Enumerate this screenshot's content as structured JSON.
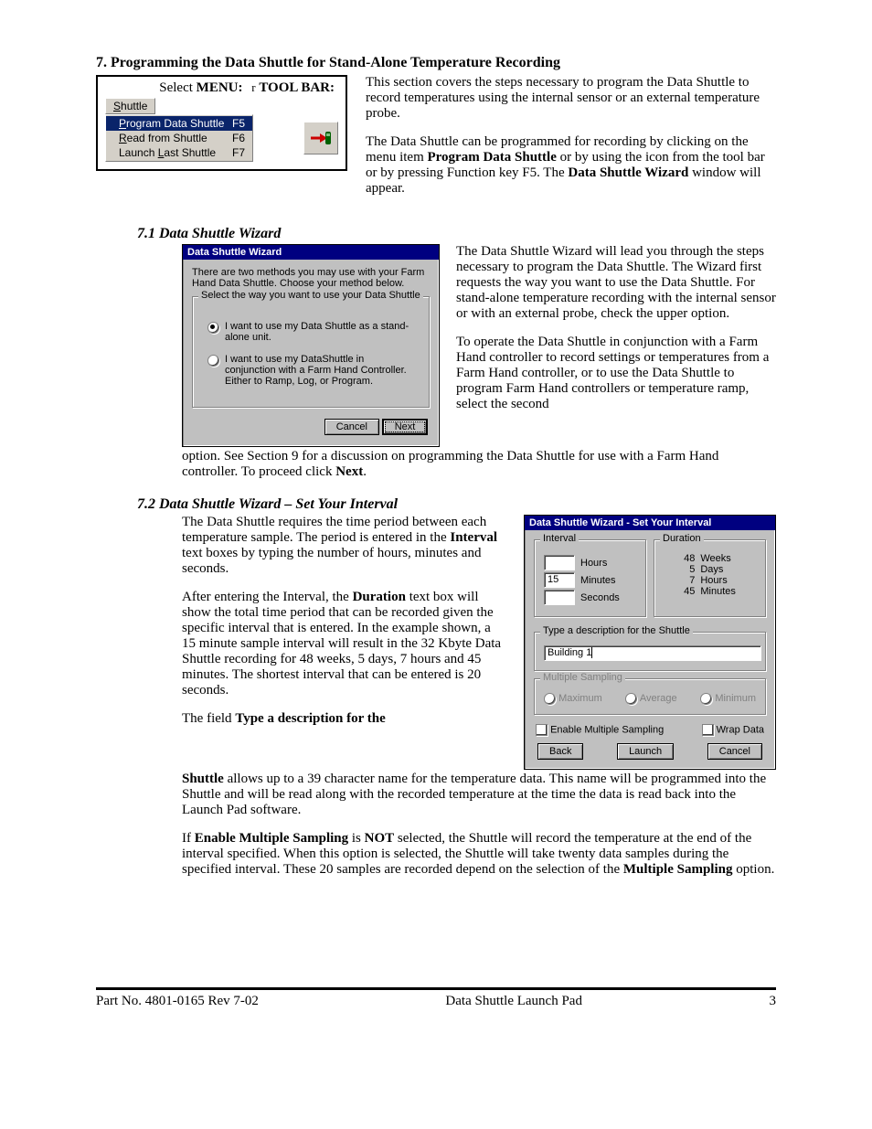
{
  "heading": "7.  Programming the Data Shuttle for Stand-Alone Temperature Recording",
  "menuFigure": {
    "selectLabel": "Select ",
    "menuWord": "MENU:",
    "or": "r",
    "toolbarWord": "TOOL BAR:",
    "shuttleBtn": "Shuttle",
    "items": [
      {
        "label": "Program Data Shuttle",
        "accel": "F5",
        "selected": true,
        "u": "P"
      },
      {
        "label": "Read from Shuttle",
        "accel": "F6",
        "selected": false,
        "u": "R"
      },
      {
        "label": "Launch Last Shuttle",
        "accel": "F7",
        "selected": false,
        "u": "L"
      }
    ]
  },
  "topPara1": "This section covers the steps necessary to program the Data Shuttle to record temperatures using the internal sensor or an external temperature probe.",
  "topPara2a": "The Data Shuttle can be programmed for recording by clicking on the menu item ",
  "topPara2bBold": "Program Data Shuttle",
  "topPara2c": " or by using the icon from the tool bar or by pressing Function key F5.  The ",
  "topPara2dBold": "Data Shuttle Wizard",
  "topPara2e": " window will appear.",
  "sub71": "7.1  Data Shuttle Wizard",
  "wizard1": {
    "title": "Data Shuttle Wizard",
    "intro": "There are two methods you may use with your Farm Hand Data Shuttle. Choose your method below.",
    "groupTitle": "Select the way you want to use your Data Shuttle",
    "opt1": "I want to use my Data Shuttle as a stand-alone unit.",
    "opt2": "I want to use my DataShuttle in conjunction with a Farm Hand Controller. Either to Ramp, Log, or Program.",
    "cancel": "Cancel",
    "next": "Next"
  },
  "rightPara71a": "The Data Shuttle Wizard will lead you through the steps necessary to program the Data Shuttle. The Wizard first requests the way you want to use the Data Shuttle. For stand-alone temperature recording with the internal sensor or with an external probe, check the upper option.",
  "rightPara71b": "To operate the Data Shuttle in conjunction with a Farm Hand controller to record settings or temperatures from a Farm Hand controller, or to use the Data Shuttle to program Farm Hand controllers or temperature ramp, select the second",
  "continuation71a": "option.  See Section 9 for a discussion on programming the Data Shuttle for use with a Farm Hand controller.  To proceed click ",
  "continuation71bBold": "Next",
  "continuation71c": ".",
  "sub72": "7.2  Data Shuttle Wizard – Set Your Interval",
  "leftPara72a1": "The Data Shuttle requires the time period between each temperature sample. The period is entered in the ",
  "leftPara72a2Bold": "Interval",
  "leftPara72a3": " text boxes by typing the number of hours, minutes and seconds.",
  "leftPara72b1": "After entering the Interval, the ",
  "leftPara72b2Bold": "Duration",
  "leftPara72b3": " text box will show the total time period that can be recorded given the specific interval that is entered.  In the example shown, a 15 minute sample interval will result in the 32 Kbyte Data Shuttle recording for 48 weeks, 5 days, 7 hours and 45 minutes.  The shortest interval that can be entered is 20 seconds.",
  "leftPara72c1": "The field ",
  "leftPara72c2Bold": "Type a description for the",
  "wizard2": {
    "title": "Data Shuttle Wizard - Set Your Interval",
    "intervalLabel": "Interval",
    "hours": "Hours",
    "minutes": "Minutes",
    "seconds": "Seconds",
    "durationLabel": "Duration",
    "d_weeks_n": "48",
    "d_weeks_l": "Weeks",
    "d_days_n": "5",
    "d_days_l": "Days",
    "d_hours_n": "7",
    "d_hours_l": "Hours",
    "d_min_n": "45",
    "d_min_l": "Minutes",
    "descLabel": "Type a description for the Shuttle",
    "descValue": "Building 1",
    "msLabel": "Multiple Sampling",
    "msMax": "Maximum",
    "msAvg": "Average",
    "msMin": "Minimum",
    "enableMS": "Enable Multiple Sampling",
    "wrapData": "Wrap Data",
    "back": "Back",
    "launch": "Launch",
    "cancel": "Cancel",
    "minutesValue": "15"
  },
  "belowPara72a1Bold": "Shuttle",
  "belowPara72a2": " allows up to a 39 character name for the temperature data.  This name will be programmed into the Shuttle and will be read along with the recorded temperature at the time the data is read back into the Launch Pad software.",
  "belowPara72b1": "If ",
  "belowPara72b2Bold": "Enable Multiple Sampling",
  "belowPara72b3": " is ",
  "belowPara72b4Bold": "NOT",
  "belowPara72b5": " selected, the Shuttle will record the temperature at the end of the interval specified.  When this option is selected, the Shuttle will take twenty data samples during the specified interval.  These 20 samples are recorded depend on the selection of the ",
  "belowPara72b6Bold": "Multiple Sampling",
  "belowPara72b7": " option.",
  "footer": {
    "left": "Part No. 4801-0165 Rev 7-02",
    "mid": "Data Shuttle Launch Pad",
    "right": "3"
  }
}
